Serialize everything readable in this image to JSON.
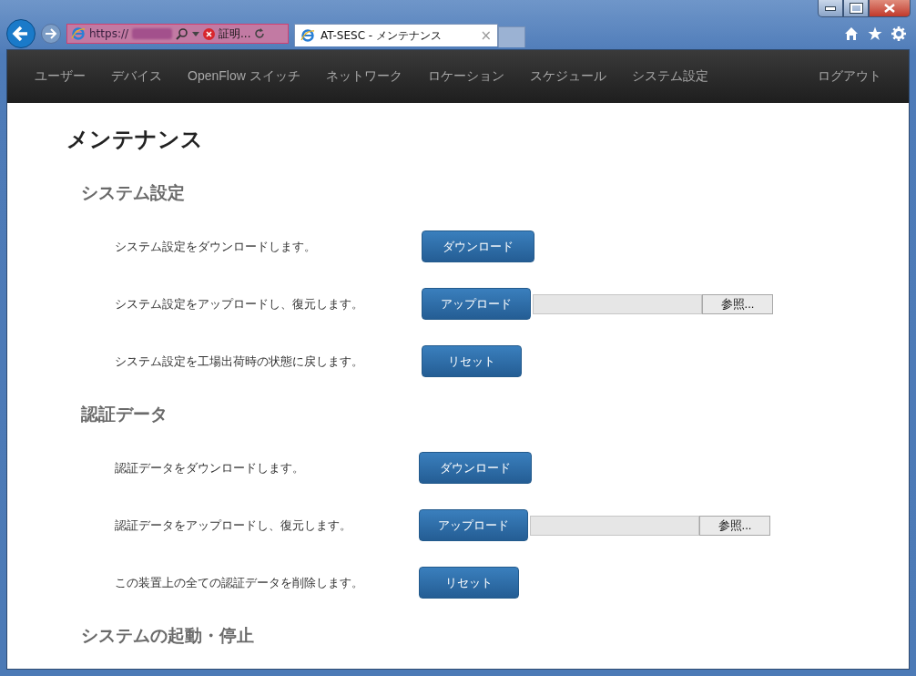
{
  "browser": {
    "address": "https://",
    "certificate_error": "証明...",
    "tabs": [
      {
        "title": "AT-SESC - メンテナンス",
        "close": "×",
        "selected": true
      }
    ]
  },
  "nav": {
    "items": [
      {
        "label": "ユーザー"
      },
      {
        "label": "デバイス"
      },
      {
        "label": "OpenFlow スイッチ"
      },
      {
        "label": "ネットワーク"
      },
      {
        "label": "ロケーション"
      },
      {
        "label": "スケジュール"
      },
      {
        "label": "システム設定"
      }
    ],
    "logout": "ログアウト"
  },
  "page": {
    "title": "メンテナンス",
    "sections": [
      {
        "heading": "システム設定",
        "rows": [
          {
            "kind": "download",
            "text": "システム設定をダウンロードします。",
            "button": "ダウンロード"
          },
          {
            "kind": "upload",
            "text": "システム設定をアップロードし、復元します。",
            "button": "アップロード",
            "browse": "参照..."
          },
          {
            "kind": "reset",
            "text": "システム設定を工場出荷時の状態に戻します。",
            "button": "リセット"
          }
        ]
      },
      {
        "heading": "認証データ",
        "rows": [
          {
            "kind": "download",
            "text": "認証データをダウンロードします。",
            "button": "ダウンロード"
          },
          {
            "kind": "upload",
            "text": "認証データをアップロードし、復元します。",
            "button": "アップロード",
            "browse": "参照..."
          },
          {
            "kind": "reset",
            "text": "この装置上の全ての認証データを削除します。",
            "button": "リセット"
          }
        ]
      },
      {
        "heading": "システムの起動・停止"
      }
    ]
  }
}
